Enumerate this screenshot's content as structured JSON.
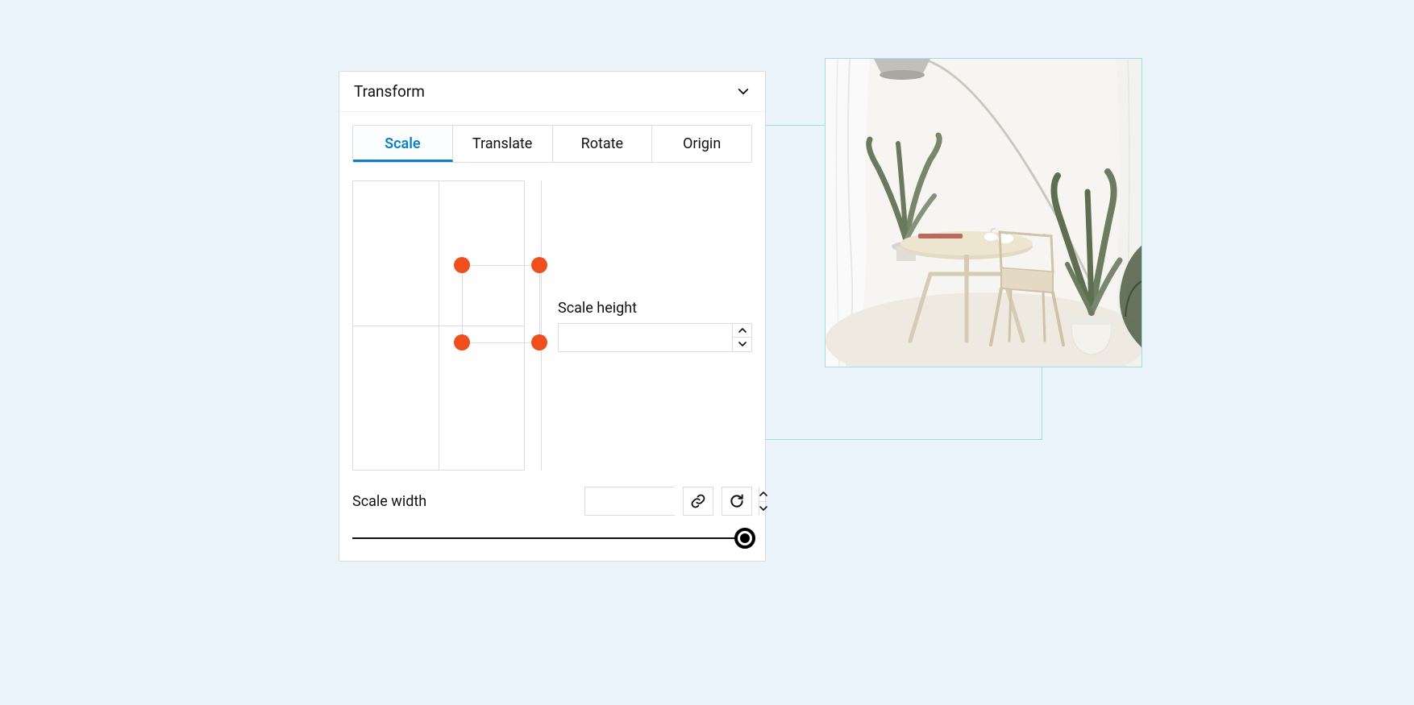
{
  "panel": {
    "title": "Transform",
    "tabs": [
      "Scale",
      "Translate",
      "Rotate",
      "Origin"
    ],
    "activeTabIndex": 0
  },
  "scale": {
    "heightLabel": "Scale height",
    "widthLabel": "Scale width",
    "heightValue": "",
    "widthValue": "",
    "dotColor": "#ef4e1d",
    "gridSize": 360
  },
  "icons": {
    "link": "link-icon",
    "reset": "reset-icon",
    "chevron": "chevron-down-icon"
  },
  "colors": {
    "accent": "#0a80c9",
    "background": "#ebf4fb",
    "connector": "#9be0dc"
  }
}
